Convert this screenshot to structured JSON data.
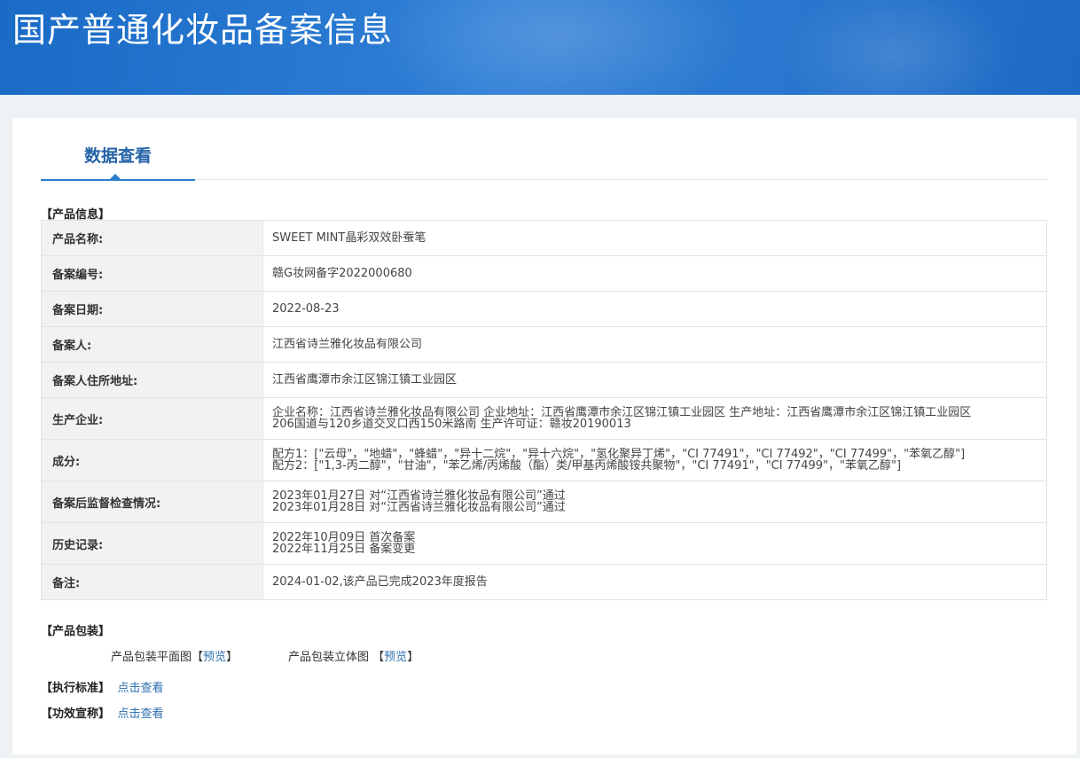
{
  "header": {
    "title": "国产普通化妆品备案信息"
  },
  "tabs": [
    {
      "label": "数据查看"
    }
  ],
  "product_info": {
    "section_title": "【产品信息】",
    "rows": [
      {
        "label": "产品名称:",
        "lines": [
          "SWEET MINT晶彩双效卧蚕笔"
        ]
      },
      {
        "label": "备案编号:",
        "lines": [
          "赣G妆网备字2022000680"
        ]
      },
      {
        "label": "备案日期:",
        "lines": [
          "2022-08-23"
        ]
      },
      {
        "label": "备案人:",
        "lines": [
          "江西省诗兰雅化妆品有限公司"
        ]
      },
      {
        "label": "备案人住所地址:",
        "lines": [
          "江西省鹰潭市余江区锦江镇工业园区"
        ]
      },
      {
        "label": "生产企业:",
        "lines": [
          "企业名称：江西省诗兰雅化妆品有限公司 企业地址：江西省鹰潭市余江区锦江镇工业园区 生产地址：江西省鹰潭市余江区锦江镇工业园区",
          "206国道与120乡道交叉口西150米路南 生产许可证：赣妆20190013"
        ]
      },
      {
        "label": "成分:",
        "lines": [
          "配方1：[\"云母\"，\"地蜡\"，\"蜂蜡\"，\"异十二烷\"，\"异十六烷\"，\"氢化聚异丁烯\"，\"CI 77491\"，\"CI 77492\"，\"CI 77499\"，\"苯氧乙醇\"]",
          "配方2：[\"1,3-丙二醇\"，\"甘油\"，\"苯乙烯/丙烯酸（酯）类/甲基丙烯酸铵共聚物\"，\"CI 77491\"，\"CI 77499\"，\"苯氧乙醇\"]"
        ]
      },
      {
        "label": "备案后监督检查情况:",
        "lines": [
          "2023年01月27日 对“江西省诗兰雅化妆品有限公司”通过",
          "2023年01月28日 对“江西省诗兰雅化妆品有限公司”通过"
        ]
      },
      {
        "label": "历史记录:",
        "lines": [
          "2022年10月09日 首次备案",
          "2022年11月25日 备案变更"
        ]
      },
      {
        "label": "备注:",
        "lines": [
          "2024-01-02,该产品已完成2023年度报告"
        ]
      }
    ]
  },
  "packaging": {
    "section_title": "【产品包装】",
    "flat_label": "产品包装平面图",
    "flat_link": "预览",
    "solid_label": "产品包装立体图",
    "solid_link": "预览",
    "open_bracket": "【",
    "close_bracket": "】"
  },
  "standard": {
    "section_title": "【执行标准】",
    "link": "点击查看"
  },
  "efficacy": {
    "section_title": "【功效宣称】",
    "link": "点击查看"
  }
}
